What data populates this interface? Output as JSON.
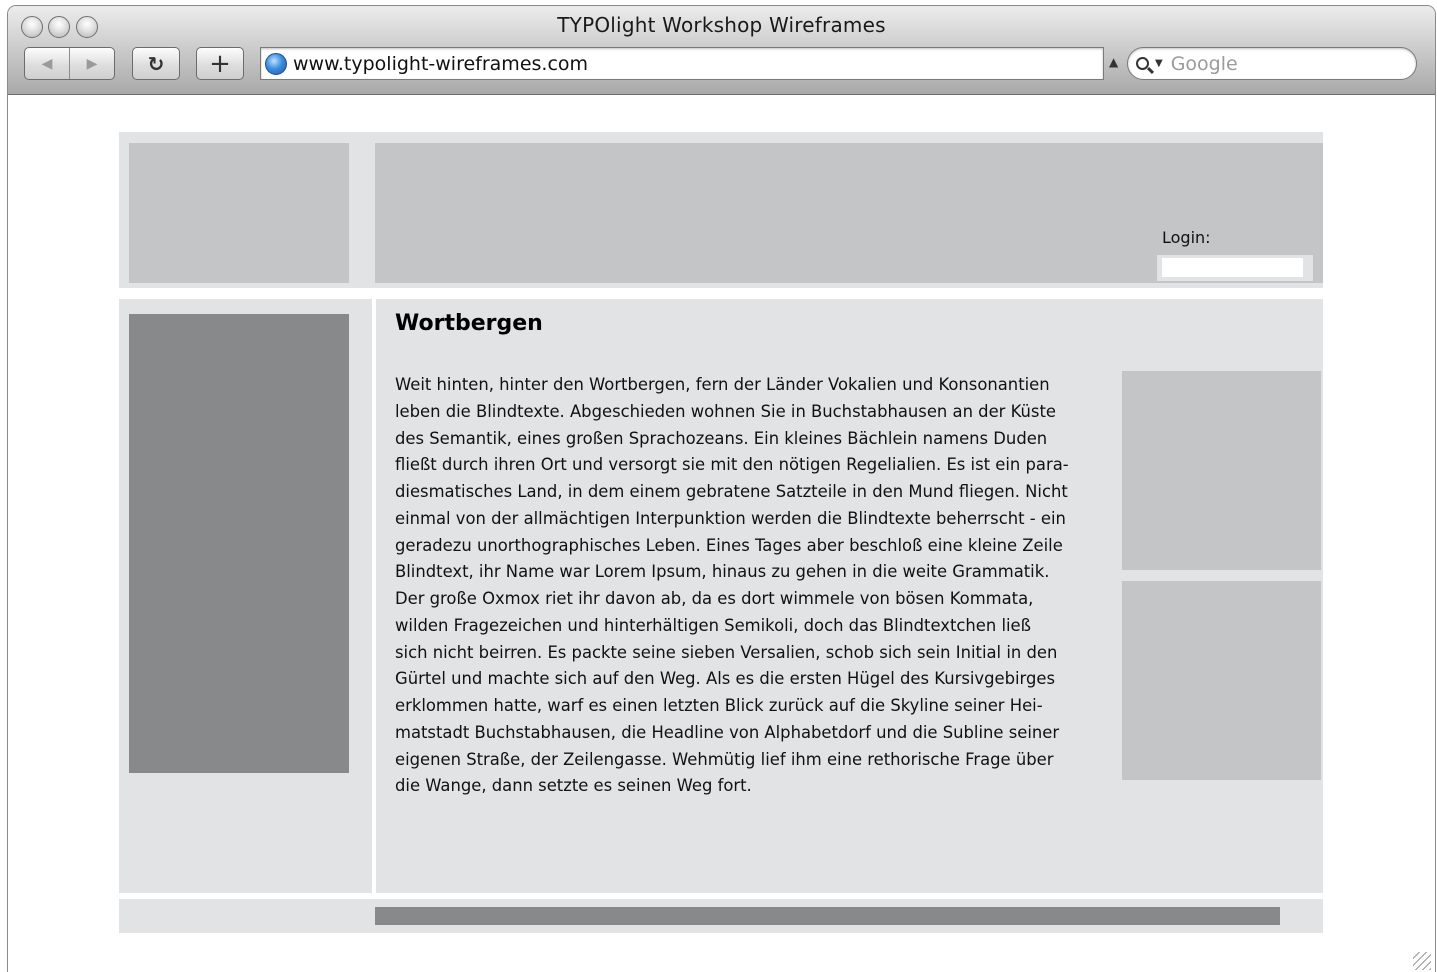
{
  "window": {
    "title": "TYPOlight Workshop Wireframes"
  },
  "toolbar": {
    "back_icon": "back-arrow-icon",
    "forward_icon": "forward-arrow-icon",
    "back_glyph": "◀",
    "forward_glyph": "▶",
    "reload_glyph": "↻",
    "add_bookmark_glyph": "+",
    "url": "www.typolight-wireframes.com",
    "search_placeholder": "Google"
  },
  "header": {
    "login_label": "Login:"
  },
  "main": {
    "title": "Wortbergen",
    "body": "Weit hinten, hinter den Wortbergen, fern der Länder Vokalien und Konsonantien\nleben die Blindtexte. Abgeschieden wohnen Sie in Buchstabhausen an der Küste\ndes Semantik, eines großen Sprachozeans. Ein kleines Bächlein namens Duden\nfließt durch ihren Ort und versorgt sie mit den nötigen Regelialien. Es ist ein para-\ndiesmatisches Land, in dem einem gebratene Satzteile in den Mund fliegen. Nicht\neinmal von der allmächtigen Interpunktion werden die Blindtexte beherrscht - ein\ngeradezu unorthographisches Leben. Eines Tages aber beschloß eine kleine Zeile\nBlindtext, ihr Name war Lorem Ipsum, hinaus zu gehen in die weite Grammatik.\nDer große Oxmox riet ihr davon ab, da es dort wimmele von bösen Kommata,\nwilden Fragezeichen und hinterhältigen Semikoli, doch das Blindtextchen ließ\nsich nicht beirren. Es packte seine sieben Versalien, schob sich sein Initial in den\nGürtel und machte sich auf den Weg. Als es die ersten Hügel des Kursivgebirges\nerklommen hatte, warf es einen letzten Blick zurück auf die Skyline seiner Hei-\nmatstadt Buchstabhausen, die Headline von Alphabetdorf und die Subline seiner\neigenen Straße, der Zeilengasse. Wehmütig lief ihm eine rethorische Frage über\ndie Wange, dann setzte es seinen Weg fort."
  },
  "colors": {
    "panel_light": "#e2e3e5",
    "panel_mid": "#c4c5c7",
    "panel_dark": "#88898b"
  }
}
